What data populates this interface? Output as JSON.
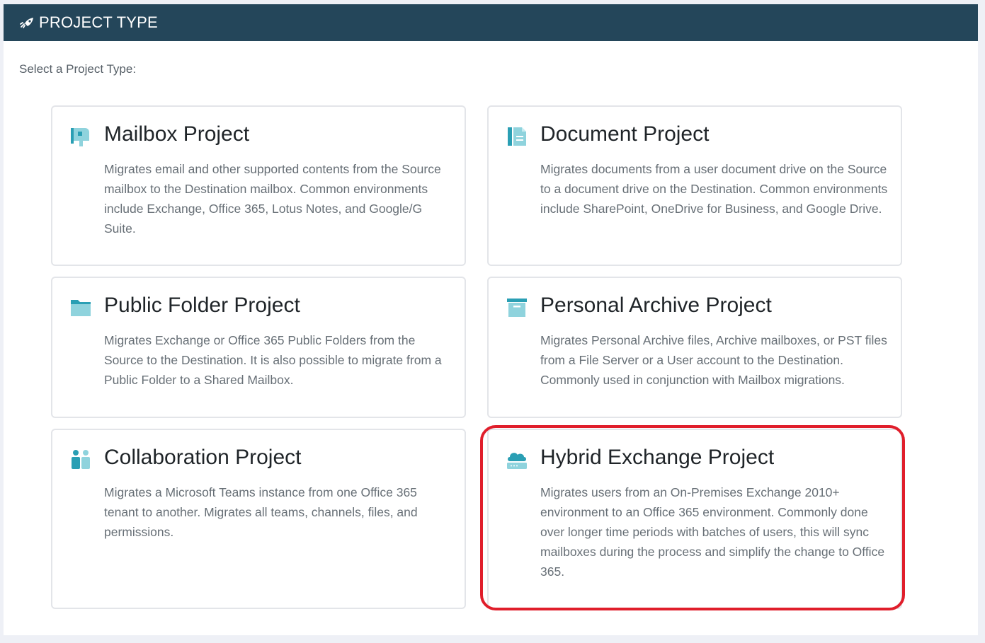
{
  "header": {
    "title": "PROJECT TYPE",
    "icon": "rocket-icon"
  },
  "subtitle": "Select a Project Type:",
  "accent_color": "#3ab4c6",
  "highlight_color": "#e01e2b",
  "cards": [
    {
      "title": "Mailbox Project",
      "icon": "mailbox-icon",
      "description": "Migrates email and other supported contents from the Source mailbox to the Destination mailbox. Common environments include Exchange, Office 365, Lotus Notes, and Google/G Suite."
    },
    {
      "title": "Document Project",
      "icon": "document-icon",
      "description": "Migrates documents from a user document drive on the Source to a document drive on the Destination. Common environments include SharePoint, OneDrive for Business, and Google Drive."
    },
    {
      "title": "Public Folder Project",
      "icon": "folder-icon",
      "description": "Migrates Exchange or Office 365 Public Folders from the Source to the Destination. It is also possible to migrate from a Public Folder to a Shared Mailbox."
    },
    {
      "title": "Personal Archive Project",
      "icon": "archive-icon",
      "description": "Migrates Personal Archive files, Archive mailboxes, or PST files from a File Server or a User account to the Destination. Commonly used in conjunction with Mailbox migrations."
    },
    {
      "title": "Collaboration Project",
      "icon": "users-icon",
      "description": "Migrates a Microsoft Teams instance from one Office 365 tenant to another. Migrates all teams, channels, files, and permissions."
    },
    {
      "title": "Hybrid Exchange Project",
      "icon": "cloud-server-icon",
      "description": "Migrates users from an On-Premises Exchange 2010+ environment to an Office 365 environment. Commonly done over longer time periods with batches of users, this will sync mailboxes during the process and simplify the change to Office 365.",
      "highlighted": true
    }
  ]
}
